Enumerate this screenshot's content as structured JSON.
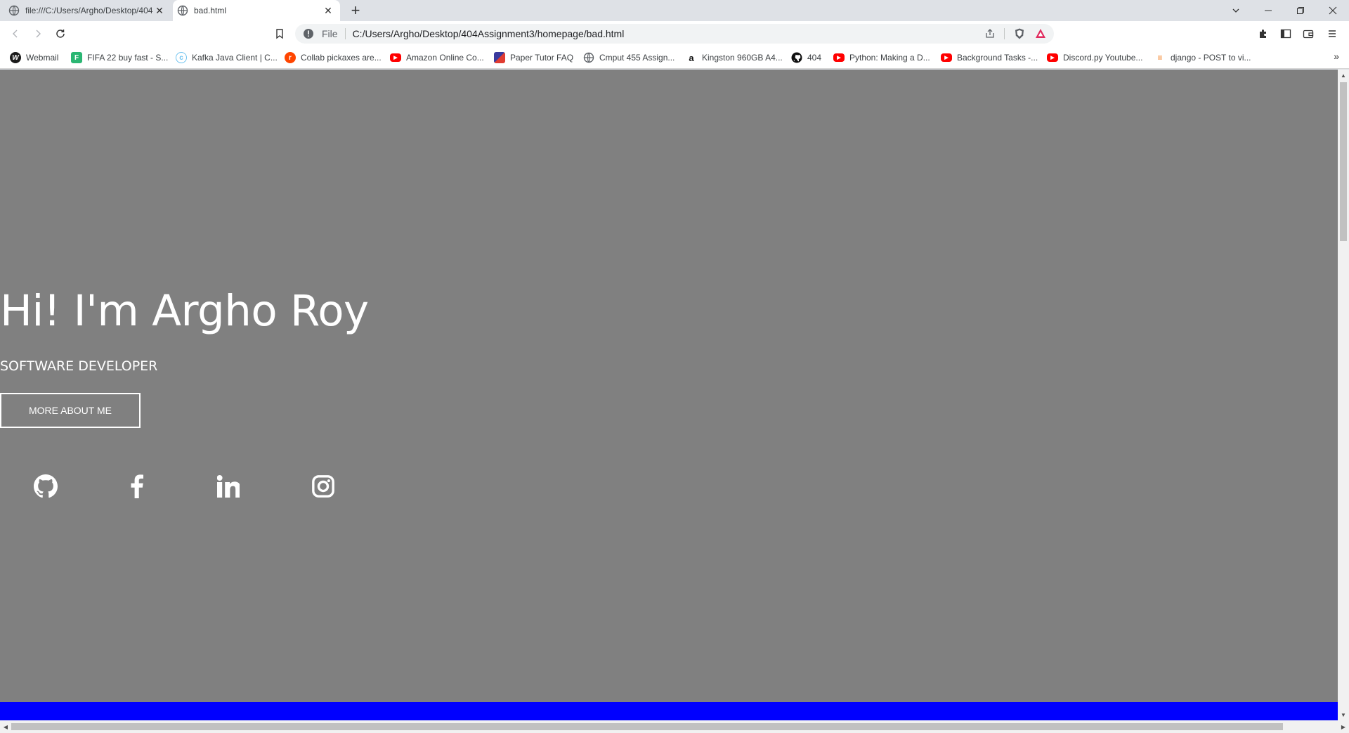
{
  "browser": {
    "tabs": [
      {
        "title": "file:///C:/Users/Argho/Desktop/404",
        "active": false
      },
      {
        "title": "bad.html",
        "active": true
      }
    ],
    "address": {
      "scheme_label": "File",
      "url": "C:/Users/Argho/Desktop/404Assignment3/homepage/bad.html"
    },
    "bookmarks": [
      {
        "label": "Webmail",
        "icon": "webmail-icon",
        "color": "#222222"
      },
      {
        "label": "FIFA 22 buy fast - S...",
        "icon": "futbin-icon",
        "color": "#2bb673"
      },
      {
        "label": "Kafka Java Client | C...",
        "icon": "confluent-icon",
        "color": "#6fc3f0"
      },
      {
        "label": "Collab pickaxes are...",
        "icon": "reddit-icon",
        "color": "#ff4500"
      },
      {
        "label": "Amazon Online Co...",
        "icon": "youtube-icon",
        "color": "#ff0000"
      },
      {
        "label": "Paper Tutor FAQ",
        "icon": "papertutor-icon",
        "color": "#3a3a9e"
      },
      {
        "label": "Cmput 455 Assign...",
        "icon": "globe-icon",
        "color": "#5f6368"
      },
      {
        "label": "Kingston 960GB A4...",
        "icon": "amazon-icon",
        "color": "#111111"
      },
      {
        "label": "404",
        "icon": "github-icon",
        "color": "#111111"
      },
      {
        "label": "Python: Making a D...",
        "icon": "youtube-icon",
        "color": "#ff0000"
      },
      {
        "label": "Background Tasks -...",
        "icon": "youtube-icon",
        "color": "#ff0000"
      },
      {
        "label": "Discord.py Youtube...",
        "icon": "youtube-icon",
        "color": "#ff0000"
      },
      {
        "label": "django - POST to vi...",
        "icon": "stackoverflow-icon",
        "color": "#f48024"
      }
    ],
    "bookmarks_overflow": "»"
  },
  "page": {
    "hero_title": "Hi! I'm Argho Roy",
    "hero_subtitle": "SOFTWARE DEVELOPER",
    "more_button": "MORE ABOUT ME",
    "social_icons": [
      "github-icon",
      "facebook-icon",
      "linkedin-icon",
      "instagram-icon"
    ],
    "background_color": "#808080",
    "footer_bar_color": "#0000ff"
  }
}
